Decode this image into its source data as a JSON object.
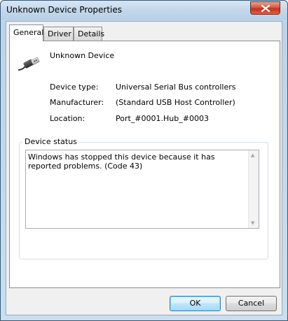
{
  "window": {
    "title": "Unknown Device Properties"
  },
  "tabs": [
    {
      "label": "General",
      "active": true
    },
    {
      "label": "Driver",
      "active": false
    },
    {
      "label": "Details",
      "active": false
    }
  ],
  "device": {
    "name": "Unknown Device",
    "icon": "usb-plug-icon",
    "properties": [
      {
        "label": "Device type:",
        "value": "Universal Serial Bus controllers"
      },
      {
        "label": "Manufacturer:",
        "value": "(Standard USB Host Controller)"
      },
      {
        "label": "Location:",
        "value": "Port_#0001.Hub_#0003"
      }
    ]
  },
  "status": {
    "legend": "Device status",
    "text": "Windows has stopped this device because it has reported problems. (Code 43)"
  },
  "buttons": {
    "ok": "OK",
    "cancel": "Cancel"
  }
}
